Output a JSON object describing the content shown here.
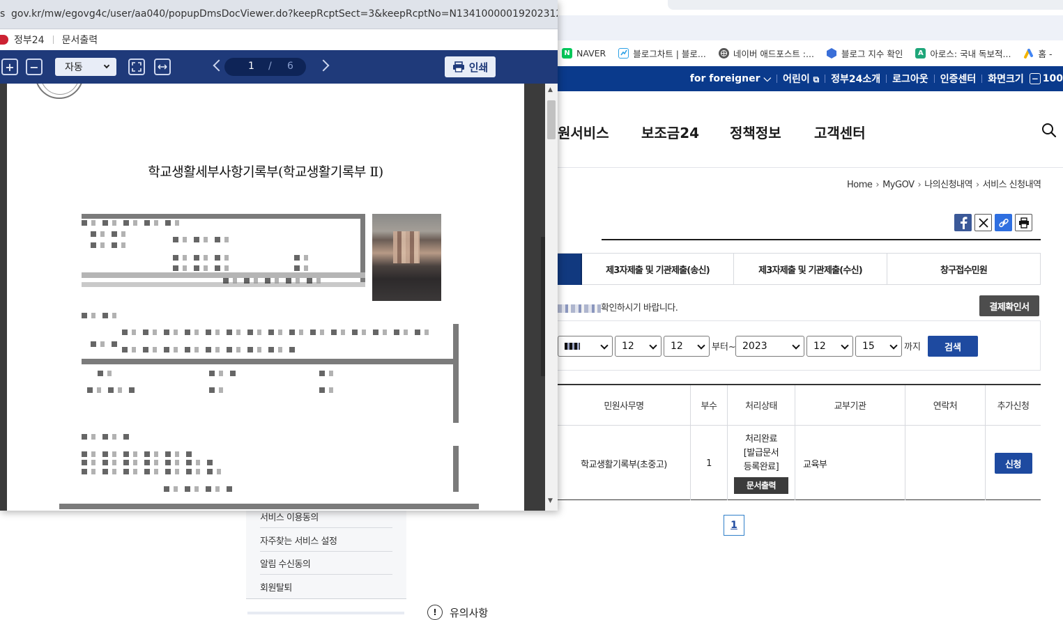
{
  "bookmarks": [
    {
      "label": "NAVER",
      "icon": "naver-icon",
      "color": "#03c75a",
      "glyph": "N"
    },
    {
      "label": "블로그차트 | 블로...",
      "icon": "blogchart-icon",
      "color": "#2aa0e6",
      "glyph": ""
    },
    {
      "label": "네이버 애드포스트 :...",
      "icon": "globe-icon",
      "color": "#555555",
      "glyph": ""
    },
    {
      "label": "블로그 지수 확인",
      "icon": "hexagon-icon",
      "color": "#3a6fd8",
      "glyph": ""
    },
    {
      "label": "아로스: 국내 독보적...",
      "icon": "aros-icon",
      "color": "#1fa67a",
      "glyph": "A"
    },
    {
      "label": "홈 -",
      "icon": "google-ads-icon",
      "color": "#f4b400",
      "glyph": ""
    }
  ],
  "util_nav": {
    "foreigner": "for foreigner",
    "kids": "어린이",
    "about": "정부24소개",
    "logout": "로그아웃",
    "cert": "인증센터",
    "screen_size": "화면크기",
    "zoom_value": "100"
  },
  "gnb": {
    "items": [
      "원서비스",
      "보조금24",
      "정책정보",
      "고객센터"
    ]
  },
  "breadcrumb": [
    "Home",
    "MyGOV",
    "나의신청내역",
    "서비스 신청내역"
  ],
  "tabs": [
    "제3자제출 및 기관제출(송신)",
    "제3자제출 및 기관제출(수신)",
    "창구접수민원"
  ],
  "notice_text": "확인하시기 바랍니다.",
  "payment_button": "결제확인서",
  "filter": {
    "from_month": "12",
    "from_day": "12",
    "from_suffix": "부터~",
    "to_year": "2023",
    "to_month": "12",
    "to_day": "15",
    "to_suffix": "까지",
    "search_button": "검색"
  },
  "table": {
    "headers": [
      "민원사무명",
      "부수",
      "처리상태",
      "교부기관",
      "연락처",
      "추가신청"
    ],
    "row": {
      "name": "학교생활기록부(초중고)",
      "copies": "1",
      "status_lines": [
        "처리완료",
        "[발급문서",
        "등록완료]"
      ],
      "print_button": "문서출력",
      "agency": "교육부",
      "contact": "",
      "apply_button": "신청"
    }
  },
  "pagination": {
    "current": "1"
  },
  "side_menu": [
    "서비스 이용동의",
    "자주찾는 서비스 설정",
    "알림 수신동의",
    "회원탈퇴"
  ],
  "caution_label": "유의사항",
  "popup": {
    "url": "gov.kr/mw/egovg4c/user/aa040/popupDmsDocViewer.do?keepRcptSect=3&keepRcptNo=N1341000001920231215788...",
    "site_name": "정부24",
    "window_title": "문서출력",
    "zoom_label": "자동",
    "page_current": "1",
    "page_separator": "/",
    "page_total": "6",
    "print_label": "인쇄",
    "doc_title": "학교생활세부사항기록부(학교생활기록부 Ⅱ)"
  }
}
